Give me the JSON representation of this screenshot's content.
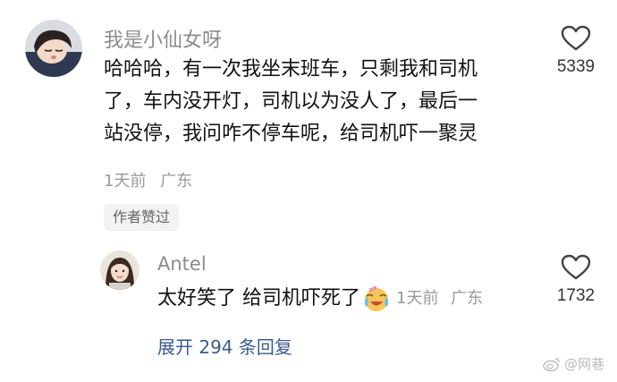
{
  "comment": {
    "username": "我是小仙女呀",
    "text_lines": [
      "哈哈哈，有一次我坐末班车，只剩我和司机",
      "了，车内没开灯，司机以为没人了，最后一",
      "站没停，我问咋不停车呢，给司机吓一聚灵"
    ],
    "time": "1天前",
    "location": "广东",
    "author_liked_label": "作者赞过",
    "like_count": "5339",
    "like_icon": "heart-outline-icon"
  },
  "reply": {
    "username": "Antel",
    "text": "太好笑了 给司机吓死了",
    "emoji_icon": "crying-laughing-emoji-icon",
    "time": "1天前",
    "location": "广东",
    "like_count": "1732",
    "like_icon": "heart-outline-icon"
  },
  "expand_replies_label": "展开 294 条回复",
  "watermark": {
    "text": "@网巷",
    "icon": "weibo-logo-icon"
  },
  "colors": {
    "link_blue": "#3b5b8f",
    "meta_gray": "#9a9a9a",
    "username_gray": "#8c8c8c"
  }
}
